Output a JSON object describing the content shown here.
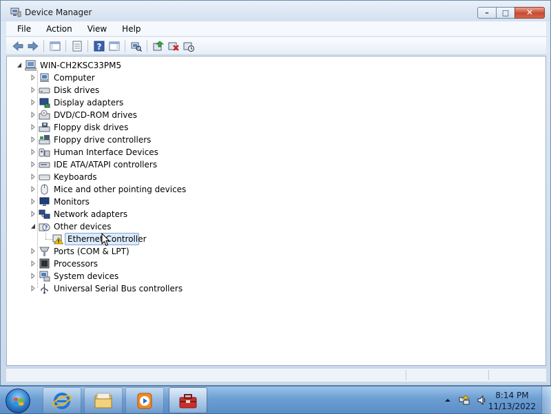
{
  "window": {
    "title": "Device Manager",
    "controls": {
      "minimize": "–",
      "maximize": "□",
      "close": "✕"
    }
  },
  "menu": [
    "File",
    "Action",
    "View",
    "Help"
  ],
  "toolbar": {
    "icons": [
      "back-arrow-icon",
      "forward-arrow-icon",
      "show-hide-tree-icon",
      "properties-icon",
      "help-icon",
      "show-hide-action-pane-icon",
      "scan-hardware-icon",
      "update-driver-icon",
      "uninstall-icon",
      "disable-device-icon"
    ]
  },
  "tree": {
    "root": "WIN-CH2KSC33PM5",
    "categories": [
      {
        "label": "Computer",
        "icon": "computer-icon"
      },
      {
        "label": "Disk drives",
        "icon": "disk-drive-icon"
      },
      {
        "label": "Display adapters",
        "icon": "display-adapter-icon"
      },
      {
        "label": "DVD/CD-ROM drives",
        "icon": "dvd-drive-icon"
      },
      {
        "label": "Floppy disk drives",
        "icon": "floppy-drive-icon"
      },
      {
        "label": "Floppy drive controllers",
        "icon": "floppy-controller-icon"
      },
      {
        "label": "Human Interface Devices",
        "icon": "hid-icon"
      },
      {
        "label": "IDE ATA/ATAPI controllers",
        "icon": "ide-controller-icon"
      },
      {
        "label": "Keyboards",
        "icon": "keyboard-icon"
      },
      {
        "label": "Mice and other pointing devices",
        "icon": "mouse-icon"
      },
      {
        "label": "Monitors",
        "icon": "monitor-icon"
      },
      {
        "label": "Network adapters",
        "icon": "network-adapter-icon"
      },
      {
        "label": "Other devices",
        "icon": "other-devices-icon"
      },
      {
        "label": "Ports (COM & LPT)",
        "icon": "port-icon"
      },
      {
        "label": "Processors",
        "icon": "processor-icon"
      },
      {
        "label": "System devices",
        "icon": "system-devices-icon"
      },
      {
        "label": "Universal Serial Bus controllers",
        "icon": "usb-icon"
      }
    ],
    "expanded_child": {
      "label": "Ethernet Controller",
      "icon": "warning-device-icon"
    }
  },
  "taskbar": {
    "apps": [
      "internet-explorer-icon",
      "windows-explorer-icon",
      "media-player-icon",
      "device-manager-task-icon"
    ],
    "tray": [
      "show-hidden-icons-icon",
      "network-icon",
      "volume-icon"
    ],
    "clock": {
      "time": "8:14 PM",
      "date": "11/13/2022"
    }
  },
  "colors": {
    "selection": "#dcebfc",
    "selection_border": "#7da2ce",
    "warning": "#f5c400"
  }
}
